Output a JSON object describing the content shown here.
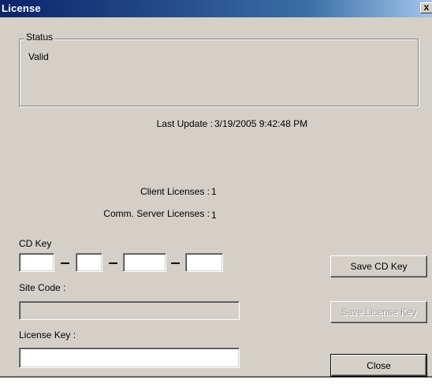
{
  "window": {
    "title": "License",
    "close_glyph": "x"
  },
  "status": {
    "group_label": "Status",
    "value": "Valid"
  },
  "last_update": {
    "label": "Last Update :",
    "value": "3/19/2005 9:42:48 PM"
  },
  "client_licenses": {
    "label": "Client Licenses :",
    "value": "1"
  },
  "comm_server_licenses": {
    "label": "Comm. Server Licenses :",
    "value": "1"
  },
  "cd_key": {
    "label": "CD Key",
    "parts": [
      "",
      "",
      "",
      ""
    ]
  },
  "site_code": {
    "label": "Site Code :",
    "value": ""
  },
  "license_key": {
    "label": "License Key :",
    "value": ""
  },
  "buttons": {
    "save_cd_key": "Save CD Key",
    "save_license_key": "Save License Key",
    "close": "Close"
  }
}
